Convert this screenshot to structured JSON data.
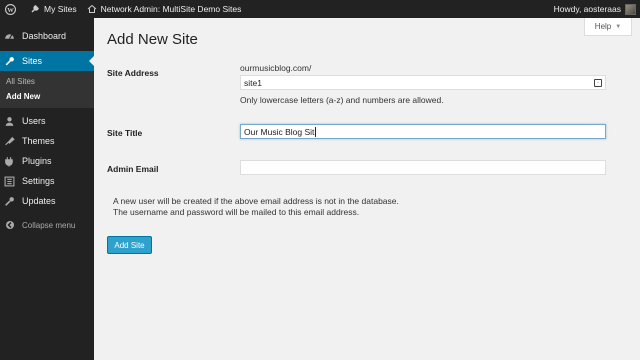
{
  "adminbar": {
    "my_sites": "My Sites",
    "network_admin": "Network Admin: MultiSite Demo Sites",
    "howdy": "Howdy, aosteraas"
  },
  "sidebar": {
    "items": [
      {
        "label": "Dashboard",
        "icon": "dashboard-icon"
      },
      {
        "label": "Sites",
        "icon": "sites-icon",
        "current": true
      },
      {
        "label": "Users",
        "icon": "users-icon"
      },
      {
        "label": "Themes",
        "icon": "themes-icon"
      },
      {
        "label": "Plugins",
        "icon": "plugins-icon"
      },
      {
        "label": "Settings",
        "icon": "settings-icon"
      },
      {
        "label": "Updates",
        "icon": "updates-icon"
      }
    ],
    "submenu": [
      "All Sites",
      "Add New"
    ],
    "collapse_label": "Collapse menu"
  },
  "help_tab": "Help",
  "page": {
    "title": "Add New Site",
    "site_address_label": "Site Address",
    "domain": "ourmusicblog.com/",
    "site_address_value": "site1",
    "site_address_hint": "Only lowercase letters (a-z) and numbers are allowed.",
    "site_title_label": "Site Title",
    "site_title_value": "Our Music Blog Sit",
    "admin_email_label": "Admin Email",
    "admin_email_value": "",
    "note_line1": "A new user will be created if the above email address is not in the database.",
    "note_line2": "The username and password will be mailed to this email address.",
    "submit_label": "Add Site"
  },
  "colors": {
    "accent": "#0074a2",
    "button": "#2ea2cc",
    "sidebar": "#222222"
  }
}
